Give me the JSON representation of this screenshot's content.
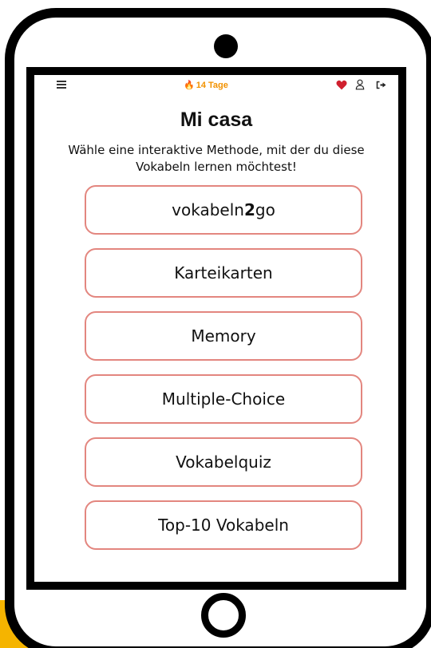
{
  "header": {
    "streak_label": "14 Tage",
    "icons": [
      "menu-icon",
      "flame-icon",
      "heart-icon",
      "user-icon",
      "logout-icon"
    ]
  },
  "page": {
    "title": "Mi casa",
    "subtitle": "Wähle eine interaktive Methode, mit der du diese Vokabeln lernen möchtest!"
  },
  "methods": {
    "vokabeln2go": {
      "prefix": "vokabeln",
      "bold": "2",
      "suffix": "go"
    },
    "karteikarten": "Karteikarten",
    "memory": "Memory",
    "multiple_choice": "Multiple-Choice",
    "vokabelquiz": "Vokabelquiz",
    "top10": "Top-10 Vokabeln"
  },
  "colors": {
    "button_border": "#e3867f",
    "streak": "#f29200",
    "heart": "#d0202e",
    "frame": "#000000",
    "corner_accent": "#f5b400"
  }
}
